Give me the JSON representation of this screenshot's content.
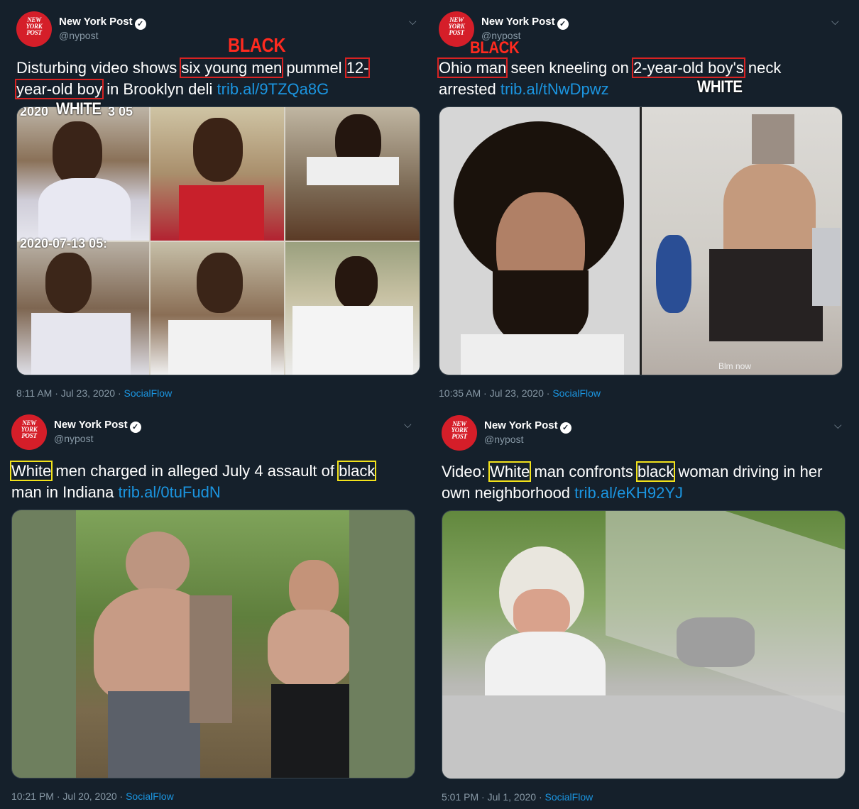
{
  "tweets": [
    {
      "account": {
        "name": "New York Post",
        "handle": "@nypost",
        "logo_lines": [
          "NEW",
          "YORK",
          "POST"
        ]
      },
      "text": {
        "pre": "Disturbing video shows ",
        "hl1": "six young men",
        "mid": " pummel ",
        "hl2a": "12-",
        "hl2b": "year-old boy",
        "post": " in Brooklyn deli ",
        "link": "trib.al/9TZQa8G"
      },
      "tags": {
        "a": "BLACK",
        "b": "WHITE"
      },
      "photo_text": {
        "stamp1": "2020",
        "stamp2": "3  05",
        "stamp3": "2020-07-13  05:"
      },
      "meta": {
        "time": "8:11 AM · Jul 23, 2020 · ",
        "source": "SocialFlow"
      }
    },
    {
      "account": {
        "name": "New York Post",
        "handle": "@nypost",
        "logo_lines": [
          "NEW",
          "YORK",
          "POST"
        ]
      },
      "text": {
        "hl1": "Ohio man",
        "mid": " seen kneeling on ",
        "hl2": "2-year-old boy's",
        "post1": " neck",
        "post2": "arrested ",
        "link": "trib.al/tNwDpwz"
      },
      "tags": {
        "a": "BLACK",
        "b": "WHITE"
      },
      "photo_text": {
        "caption": "Blm now"
      },
      "meta": {
        "time": "10:35 AM · Jul 23, 2020 · ",
        "source": "SocialFlow"
      }
    },
    {
      "account": {
        "name": "New York Post",
        "handle": "@nypost",
        "logo_lines": [
          "NEW",
          "YORK",
          "POST"
        ]
      },
      "text": {
        "hl1": "White",
        "mid": " men charged in alleged July 4 assault of ",
        "hl2": "black",
        "line2": "man in Indiana ",
        "link": "trib.al/0tuFudN"
      },
      "meta": {
        "time": "10:21 PM · Jul 20, 2020 · ",
        "source": "SocialFlow"
      }
    },
    {
      "account": {
        "name": "New York Post",
        "handle": "@nypost",
        "logo_lines": [
          "NEW",
          "YORK",
          "POST"
        ]
      },
      "text": {
        "pre": "Video: ",
        "hl1": "White",
        "mid": " man confronts ",
        "hl2": "black",
        "post": " woman driving in her",
        "line2": "own neighborhood ",
        "link": "trib.al/eKH92YJ"
      },
      "meta": {
        "time": "5:01 PM · Jul 1, 2020 · ",
        "source": "SocialFlow"
      }
    }
  ],
  "icons": {
    "verified": "verified-badge-icon",
    "caret": "chevron-down-icon"
  },
  "colors": {
    "background": "#15202b",
    "link": "#1b95e0",
    "muted": "#8899a6",
    "red_box": "#d82222",
    "yellow_box": "#f2e21b",
    "brand": "#d51e29"
  }
}
